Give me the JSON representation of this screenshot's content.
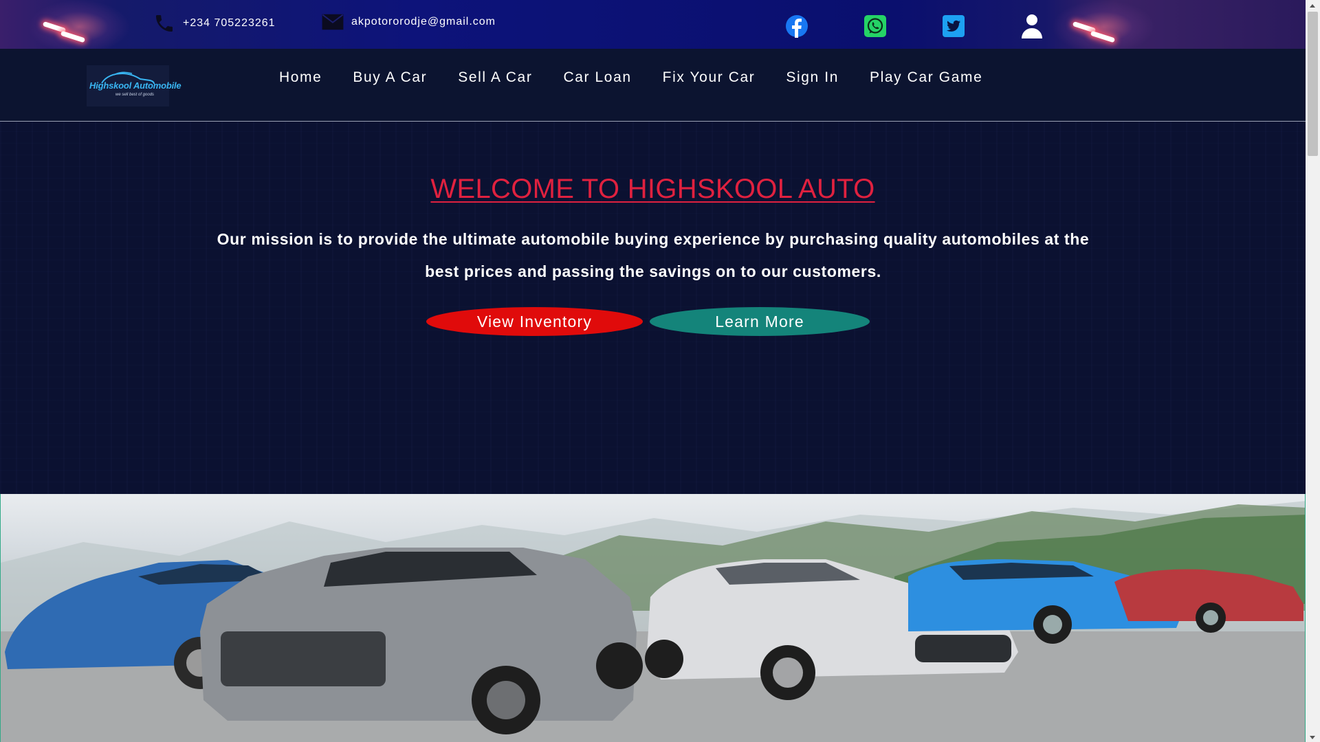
{
  "topbar": {
    "phone": "+234 705223261",
    "email": "akpotororodje@gmail.com",
    "social": [
      {
        "icon": "facebook-icon",
        "color": "#1877f2"
      },
      {
        "icon": "whatsapp-icon",
        "color": "#25d366"
      },
      {
        "icon": "twitter-icon",
        "color": "#1da1f2"
      },
      {
        "icon": "user-account-icon",
        "color": "#ffffff"
      }
    ]
  },
  "logo": {
    "name": "Highskool Automobile",
    "tagline": "we sell best of goods"
  },
  "nav": {
    "items": [
      "Home",
      "Buy A Car",
      "Sell A Car",
      "Car Loan",
      "Fix Your Car",
      "Sign In",
      "Play Car Game"
    ]
  },
  "hero": {
    "title": "WELCOME TO HIGHSKOOL AUTO",
    "mission": "Our mission is to provide the ultimate automobile buying experience by purchasing quality automobiles at the best prices and passing the savings on to our customers.",
    "primary_button": "View Inventory",
    "secondary_button": "Learn More"
  },
  "colors": {
    "title_red": "#e0213f",
    "button_red": "#e00b0b",
    "button_teal": "#14847a",
    "nav_bg": "#0c1430",
    "topbar_bg": "#0d137a"
  }
}
